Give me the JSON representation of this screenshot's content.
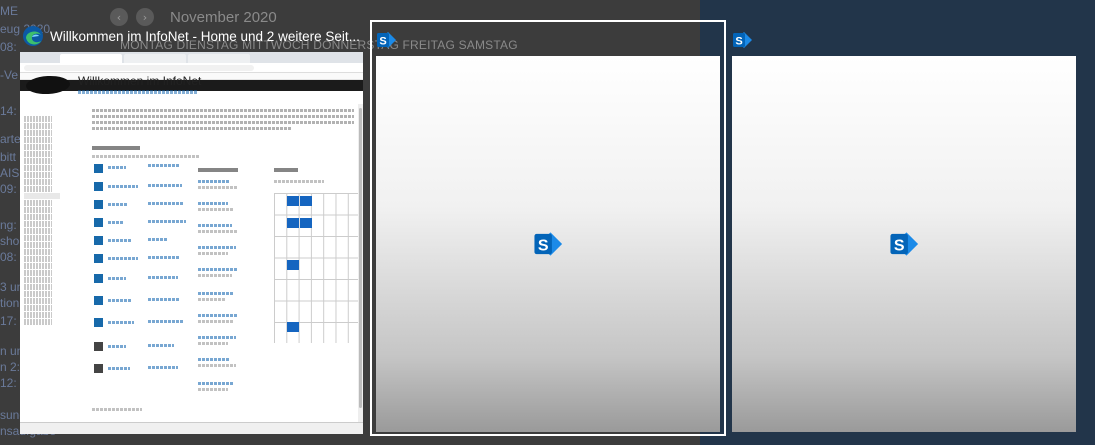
{
  "backdrop": {
    "calendar_month": "November 2020",
    "weekday_row": "MONTAG DIENSTAG MITTWOCH DONNERSTAG FREITAG SAMSTAG",
    "prev_glyph": "‹",
    "next_glyph": "›",
    "side_fragments": [
      "ME",
      "eug 2020",
      "08:",
      "-Ve",
      "14:",
      "arte",
      "bitt",
      "AIS",
      "09:",
      "ng: 2",
      "sho",
      "08:",
      "3 un",
      "tion",
      "17:",
      "n und",
      "n 2:",
      "12:",
      "sung",
      "nsaufgabe"
    ]
  },
  "windows": [
    {
      "app_icon": "edge-icon",
      "title": "Willkommen im InfoNet - Home und 2 weitere Seit...",
      "thumbnail": {
        "page_heading": "Willkommen im InfoNet"
      }
    },
    {
      "app_icon": "sharepoint-icon",
      "title": "",
      "selected": true
    },
    {
      "app_icon": "sharepoint-icon",
      "title": ""
    }
  ],
  "colors": {
    "sharepoint_blue": "#0364b8",
    "sharepoint_light": "#1b8ae8",
    "focus_border": "#ffffff",
    "edge_blue": "#0c59a4",
    "edge_green": "#3ebf6d"
  }
}
